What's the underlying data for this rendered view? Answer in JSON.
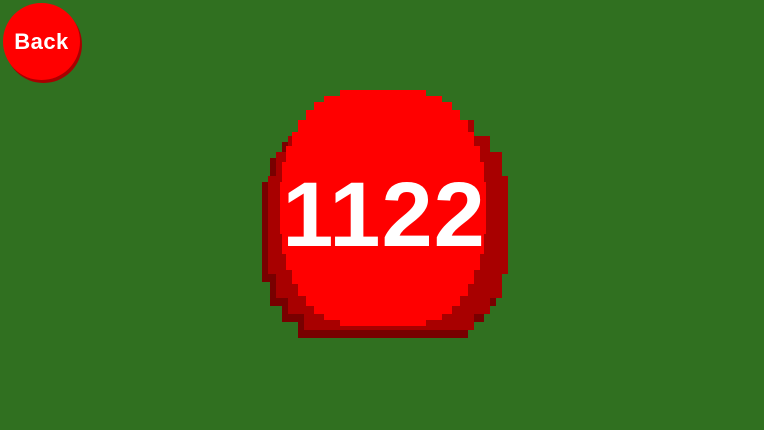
{
  "back_button": {
    "label": "Back"
  },
  "counter": {
    "value": "1122"
  },
  "colors": {
    "background": "#307020",
    "button": "#ff0000",
    "button_shadow": "#a80000",
    "button_shadow_dark": "#780000",
    "text": "#ffffff"
  }
}
